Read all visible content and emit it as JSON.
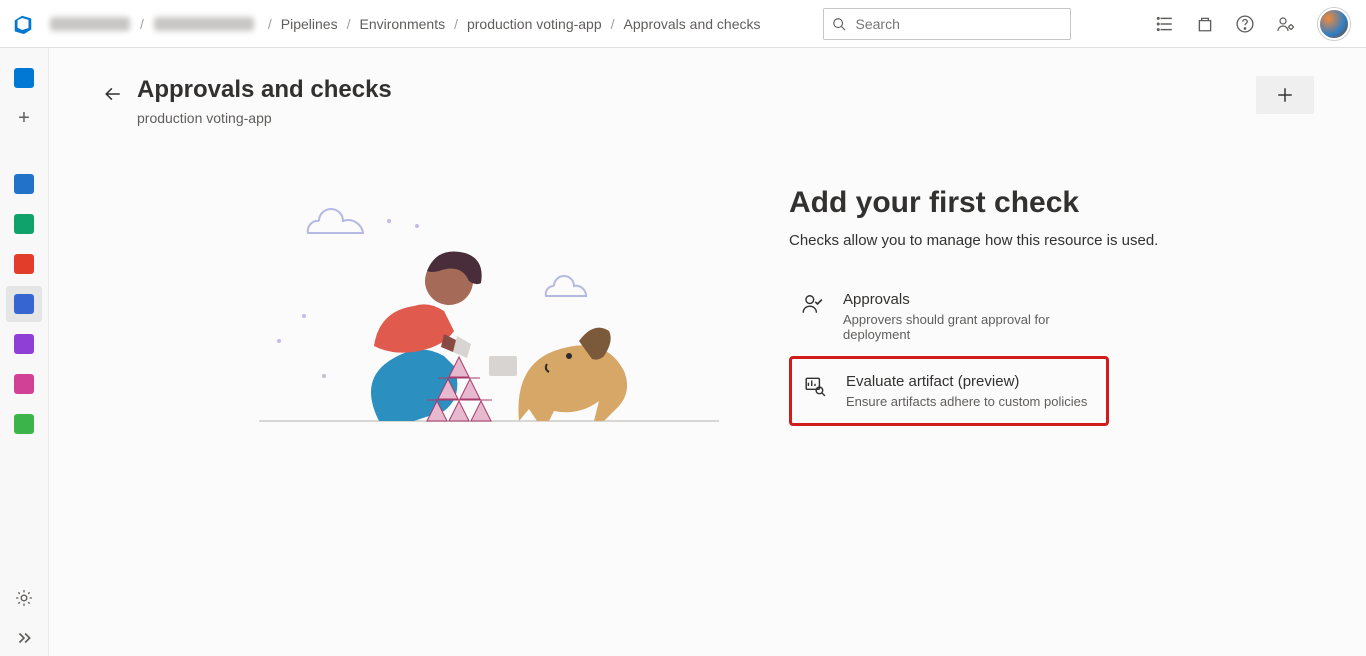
{
  "breadcrumb": {
    "items": [
      "Pipelines",
      "Environments",
      "production voting-app",
      "Approvals and checks"
    ]
  },
  "search": {
    "placeholder": "Search"
  },
  "page": {
    "title": "Approvals and checks",
    "subtitle": "production voting-app"
  },
  "empty_state": {
    "heading": "Add your first check",
    "description": "Checks allow you to manage how this resource is used.",
    "options": [
      {
        "title": "Approvals",
        "desc": "Approvers should grant approval for deployment"
      },
      {
        "title": "Evaluate artifact (preview)",
        "desc": "Ensure artifacts adhere to custom policies"
      }
    ]
  },
  "colors": {
    "accent": "#0078d4",
    "highlight_border": "#d21c1c"
  }
}
